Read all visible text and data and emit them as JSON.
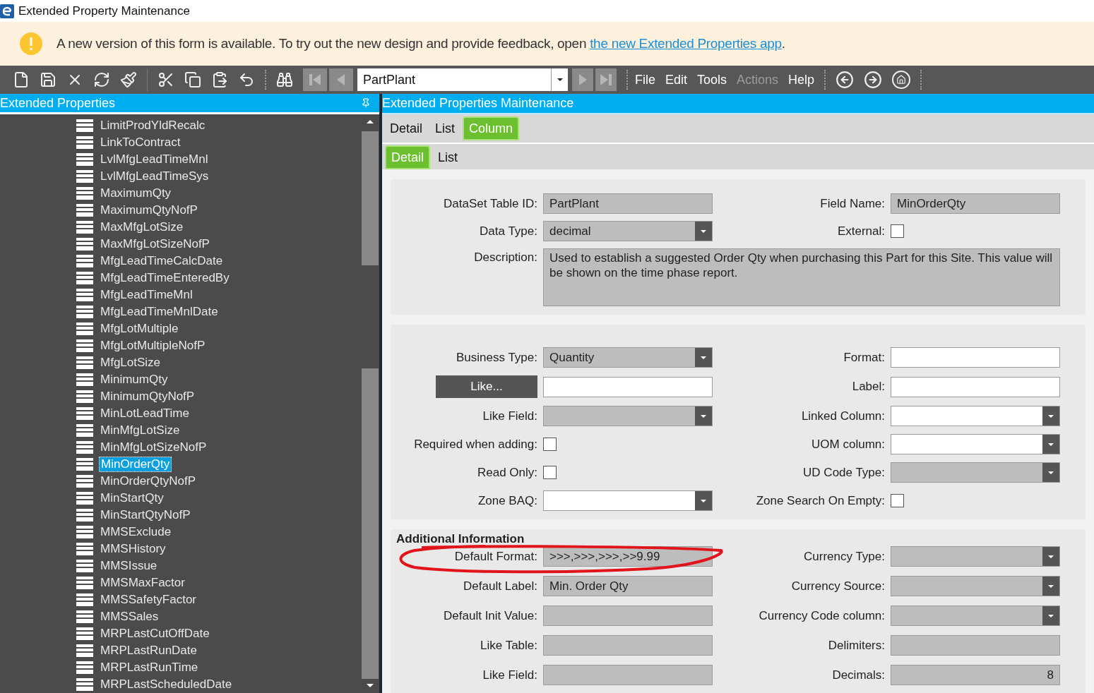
{
  "window": {
    "title": "Extended Property Maintenance"
  },
  "banner": {
    "text_before": "A new version of this form is available. To try out the new design and provide feedback, open ",
    "link": "the new Extended Properties app",
    "text_after": "."
  },
  "toolbar": {
    "combo": {
      "value": "PartPlant"
    },
    "menus": [
      {
        "label": "File",
        "disabled": false
      },
      {
        "label": "Edit",
        "disabled": false
      },
      {
        "label": "Tools",
        "disabled": false
      },
      {
        "label": "Actions",
        "disabled": true
      },
      {
        "label": "Help",
        "disabled": false
      }
    ]
  },
  "sidebar": {
    "title": "Extended Properties",
    "items": [
      {
        "label": "LimitProdYldRecalc",
        "selected": false
      },
      {
        "label": "LinkToContract",
        "selected": false
      },
      {
        "label": "LvlMfgLeadTimeMnl",
        "selected": false
      },
      {
        "label": "LvlMfgLeadTimeSys",
        "selected": false
      },
      {
        "label": "MaximumQty",
        "selected": false
      },
      {
        "label": "MaximumQtyNofP",
        "selected": false
      },
      {
        "label": "MaxMfgLotSize",
        "selected": false
      },
      {
        "label": "MaxMfgLotSizeNofP",
        "selected": false
      },
      {
        "label": "MfgLeadTimeCalcDate",
        "selected": false
      },
      {
        "label": "MfgLeadTimeEnteredBy",
        "selected": false
      },
      {
        "label": "MfgLeadTimeMnl",
        "selected": false
      },
      {
        "label": "MfgLeadTimeMnlDate",
        "selected": false
      },
      {
        "label": "MfgLotMultiple",
        "selected": false
      },
      {
        "label": "MfgLotMultipleNofP",
        "selected": false
      },
      {
        "label": "MfgLotSize",
        "selected": false
      },
      {
        "label": "MinimumQty",
        "selected": false
      },
      {
        "label": "MinimumQtyNofP",
        "selected": false
      },
      {
        "label": "MinLotLeadTime",
        "selected": false
      },
      {
        "label": "MinMfgLotSize",
        "selected": false
      },
      {
        "label": "MinMfgLotSizeNofP",
        "selected": false
      },
      {
        "label": "MinOrderQty",
        "selected": true
      },
      {
        "label": "MinOrderQtyNofP",
        "selected": false
      },
      {
        "label": "MinStartQty",
        "selected": false
      },
      {
        "label": "MinStartQtyNofP",
        "selected": false
      },
      {
        "label": "MMSExclude",
        "selected": false
      },
      {
        "label": "MMSHistory",
        "selected": false
      },
      {
        "label": "MMSIssue",
        "selected": false
      },
      {
        "label": "MMSMaxFactor",
        "selected": false
      },
      {
        "label": "MMSSafetyFactor",
        "selected": false
      },
      {
        "label": "MMSSales",
        "selected": false
      },
      {
        "label": "MRPLastCutOffDate",
        "selected": false
      },
      {
        "label": "MRPLastRunDate",
        "selected": false
      },
      {
        "label": "MRPLastRunTime",
        "selected": false
      },
      {
        "label": "MRPLastScheduledDate",
        "selected": false
      }
    ]
  },
  "main": {
    "title": "Extended Properties Maintenance",
    "tabs": [
      {
        "label": "Detail",
        "selected": false
      },
      {
        "label": "List",
        "selected": false
      },
      {
        "label": "Column",
        "selected": true
      }
    ],
    "subtabs": [
      {
        "label": "Detail",
        "selected": true
      },
      {
        "label": "List",
        "selected": false
      }
    ],
    "sections": [
      {
        "rows": [
          [
            {
              "kind": "readonly",
              "label": "DataSet Table ID:",
              "value": "PartPlant"
            },
            {
              "kind": "readonly",
              "label": "Field Name:",
              "value": "MinOrderQty"
            }
          ],
          [
            {
              "kind": "select-readonly",
              "label": "Data Type:",
              "value": "decimal"
            },
            {
              "kind": "checkbox",
              "label": "External:",
              "checked": false
            }
          ]
        ],
        "description": {
          "label": "Description:",
          "value": "Used to establish a suggested Order Qty when purchasing this Part for this Site. This value will be shown on the time phase report."
        }
      },
      {
        "rows": [
          [
            {
              "kind": "select-readonly",
              "label": "Business Type:",
              "value": "Quantity"
            },
            {
              "kind": "input",
              "label": "Format:"
            }
          ],
          [
            {
              "kind": "button-input",
              "label": "Like..."
            },
            {
              "kind": "input",
              "label": "Label:"
            }
          ],
          [
            {
              "kind": "select-readonly",
              "label": "Like Field:"
            },
            {
              "kind": "select",
              "label": "Linked Column:"
            }
          ],
          [
            {
              "kind": "checkbox",
              "label": "Required when adding:",
              "checked": false
            },
            {
              "kind": "select",
              "label": "UOM column:"
            }
          ],
          [
            {
              "kind": "checkbox",
              "label": "Read Only:",
              "checked": false
            },
            {
              "kind": "select-readonly",
              "label": "UD Code Type:"
            }
          ],
          [
            {
              "kind": "select",
              "label": "Zone BAQ:"
            },
            {
              "kind": "checkbox",
              "label": "Zone Search On Empty:",
              "checked": false
            }
          ]
        ]
      },
      {
        "title": "Additional Information",
        "rows": [
          [
            {
              "kind": "readonly",
              "label": "Default Format:",
              "value": ">>>,>>>,>>>,>>9.99"
            },
            {
              "kind": "select-readonly",
              "label": "Currency Type:"
            }
          ],
          [
            {
              "kind": "readonly",
              "label": "Default Label:",
              "value": "Min. Order Qty"
            },
            {
              "kind": "select-readonly",
              "label": "Currency Source:"
            }
          ],
          [
            {
              "kind": "readonly",
              "label": "Default Init Value:"
            },
            {
              "kind": "select-readonly",
              "label": "Currency Code column:"
            }
          ],
          [
            {
              "kind": "readonly",
              "label": "Like Table:"
            },
            {
              "kind": "readonly",
              "label": "Delimiters:"
            }
          ],
          [
            {
              "kind": "readonly",
              "label": "Like Field:"
            },
            {
              "kind": "number",
              "label": "Decimals:",
              "value": "8"
            }
          ]
        ]
      }
    ]
  }
}
